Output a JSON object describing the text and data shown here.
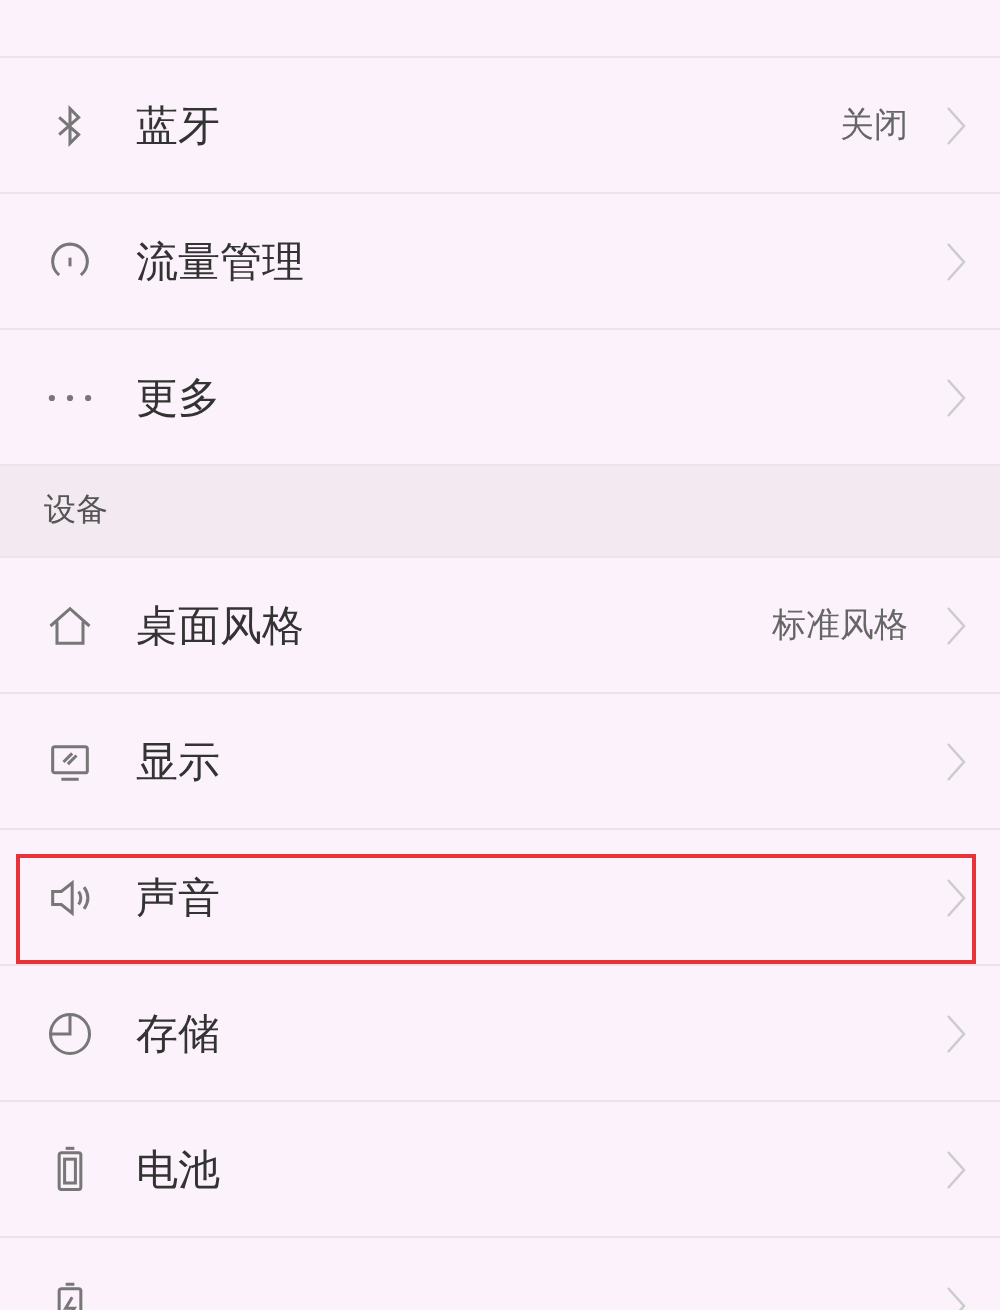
{
  "items": [
    {
      "kind": "row",
      "label": "蓝牙",
      "value": "关闭",
      "highlighted": false
    },
    {
      "kind": "row",
      "label": "流量管理",
      "highlighted": false
    },
    {
      "kind": "row",
      "label": "更多",
      "highlighted": false
    },
    {
      "kind": "header",
      "label": "设备"
    },
    {
      "kind": "row",
      "label": "桌面风格",
      "value": "标准风格",
      "highlighted": false
    },
    {
      "kind": "row",
      "label": "显示",
      "highlighted": false
    },
    {
      "kind": "row",
      "label": "声音",
      "highlighted": true
    },
    {
      "kind": "row",
      "label": "存储",
      "highlighted": false
    },
    {
      "kind": "row",
      "label": "电池",
      "highlighted": false
    },
    {
      "kind": "cut_row"
    }
  ]
}
